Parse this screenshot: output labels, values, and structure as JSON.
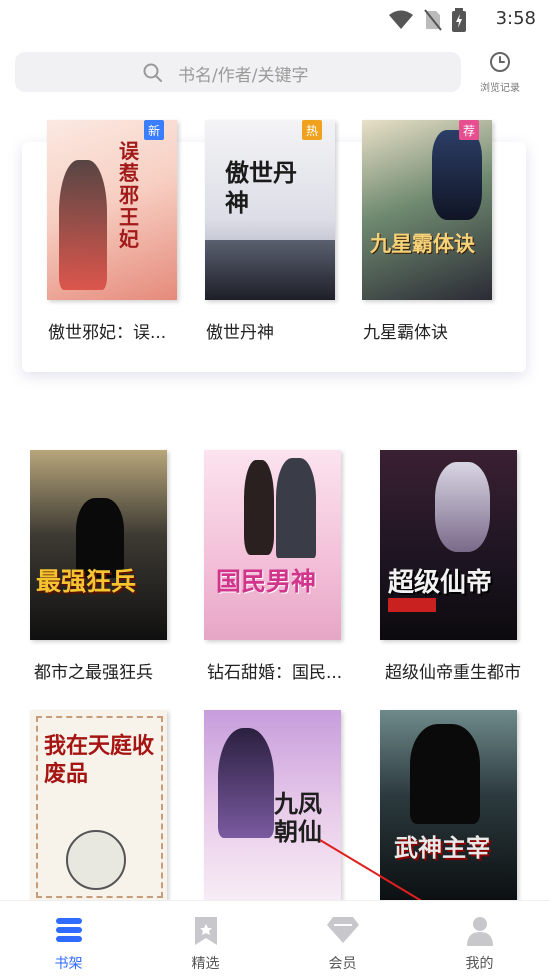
{
  "status_bar": {
    "time": "3:58"
  },
  "search": {
    "placeholder": "书名/作者/关键字",
    "history_label": "浏览记录"
  },
  "featured": [
    {
      "title": "傲世邪妃：误...",
      "badge": "新",
      "badge_color": "#3b7dff",
      "cover_text": "误惹邪王妃"
    },
    {
      "title": "傲世丹神",
      "badge": "热",
      "badge_color": "#f0a21e",
      "cover_text": "傲世丹神"
    },
    {
      "title": "九星霸体诀",
      "badge": "荐",
      "badge_color": "#e64e8f",
      "cover_text": "九星霸体诀"
    }
  ],
  "shelf_row1": [
    {
      "title": "都市之最强狂兵",
      "cover_text": "最强狂兵"
    },
    {
      "title": "钻石甜婚：国民...",
      "cover_text": "国民男神"
    },
    {
      "title": "超级仙帝重生都市",
      "cover_text": "超级仙帝"
    }
  ],
  "shelf_row2": [
    {
      "cover_text": "我在天庭收废品"
    },
    {
      "cover_text": "九凤朝仙"
    },
    {
      "cover_text": "武神主宰"
    }
  ],
  "tabs": [
    {
      "label": "书架",
      "icon": "bookshelf-icon",
      "active": true
    },
    {
      "label": "精选",
      "icon": "bookmark-icon",
      "active": false
    },
    {
      "label": "会员",
      "icon": "diamond-icon",
      "active": false
    },
    {
      "label": "我的",
      "icon": "person-icon",
      "active": false
    }
  ],
  "colors": {
    "accent": "#2f6bff",
    "inactive_icon": "#c8c8cc"
  }
}
